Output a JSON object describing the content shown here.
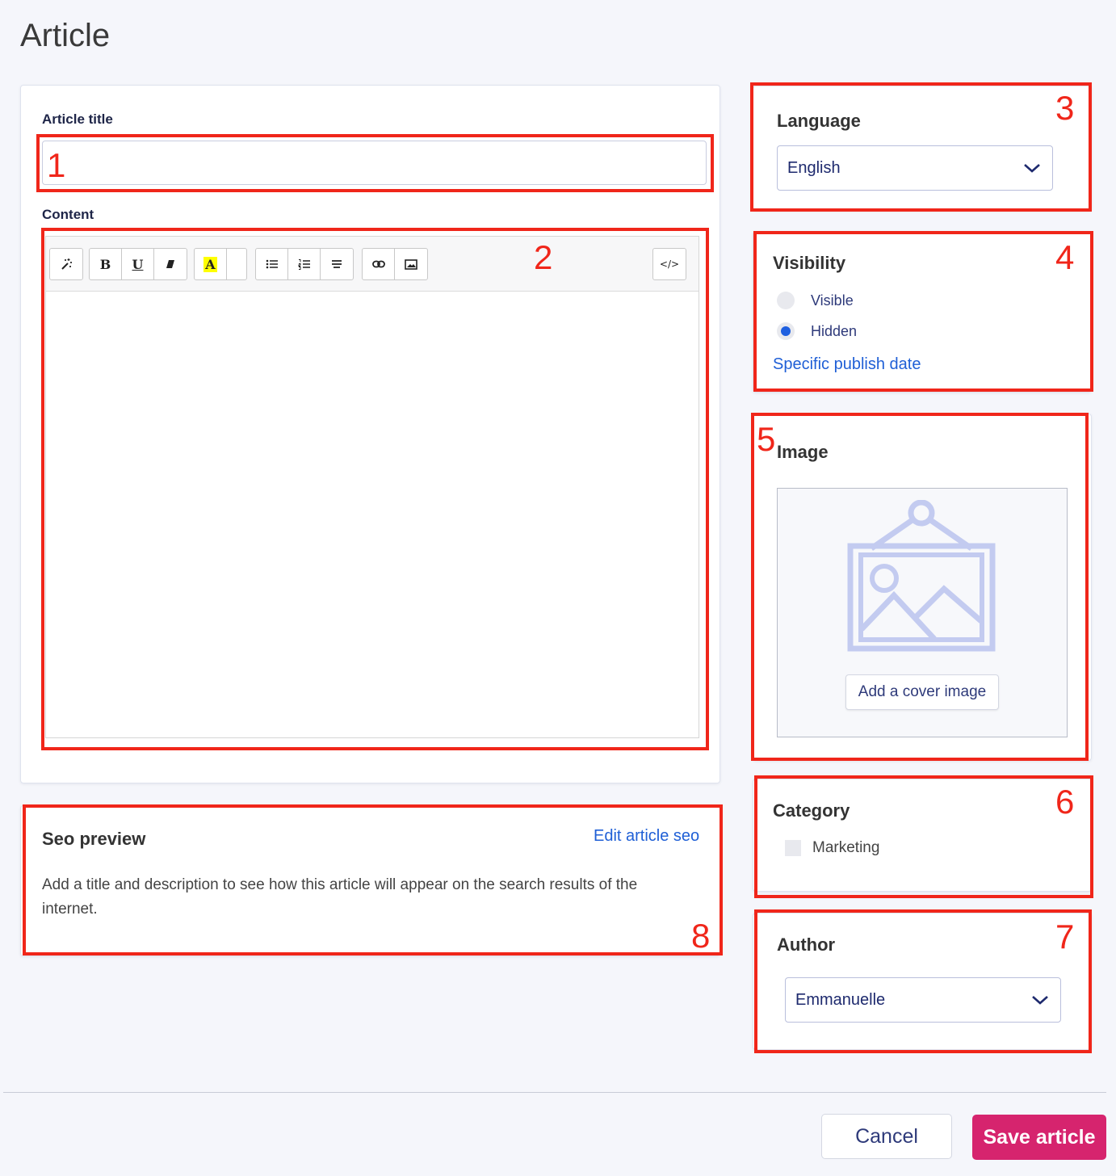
{
  "page": {
    "title": "Article"
  },
  "article_title": {
    "label": "Article title",
    "value": "",
    "marker": "1"
  },
  "content": {
    "label": "Content",
    "marker": "2",
    "toolbar": {
      "style_icon": "magic-wand-icon",
      "bold": "B",
      "underline": "U",
      "clear_format": "eraser-icon",
      "highlight": "A",
      "highlight_color": "#ffff00",
      "bullet_list": "unordered-list-icon",
      "numbered_list": "ordered-list-icon",
      "align": "align-icon",
      "link": "link-icon",
      "image": "image-icon",
      "code_view": "</>"
    }
  },
  "language": {
    "title": "Language",
    "value": "English",
    "marker": "3"
  },
  "visibility": {
    "title": "Visibility",
    "marker": "4",
    "options": [
      {
        "label": "Visible",
        "checked": false
      },
      {
        "label": "Hidden",
        "checked": true
      }
    ],
    "publish_link": "Specific publish date"
  },
  "image": {
    "title": "Image",
    "marker": "5",
    "button": "Add a cover image",
    "placeholder_icon": "picture-frame-icon"
  },
  "category": {
    "title": "Category",
    "marker": "6",
    "items": [
      {
        "label": "Marketing",
        "checked": false
      }
    ]
  },
  "author": {
    "title": "Author",
    "value": "Emmanuelle",
    "marker": "7"
  },
  "seo": {
    "title": "Seo preview",
    "edit_link": "Edit article seo",
    "description": "Add a title and description to see how this article will appear on the search results of the internet.",
    "marker": "8"
  },
  "footer": {
    "cancel": "Cancel",
    "save": "Save article"
  },
  "colors": {
    "annotation": "#f0261a",
    "accent": "#d6246e",
    "link": "#1f5fd6"
  }
}
